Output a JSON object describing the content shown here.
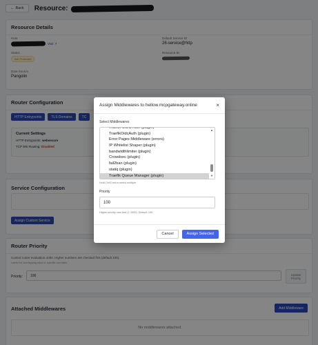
{
  "topbar": {
    "back_label": "Back",
    "title_prefix": "Resource:"
  },
  "resource_details": {
    "title": "Resource Details",
    "host_label": "Host",
    "visit_label": "Visit",
    "status_label": "Status",
    "status_value": "Not Protected",
    "datasource_label": "Data Source",
    "datasource_value": "Pangolin",
    "service_id_label": "Default Service ID",
    "service_id_value": "26-service@http",
    "resource_id_label": "Resource ID"
  },
  "router_config": {
    "title": "Router Configuration",
    "tabs": [
      "HTTP Entrypoints",
      "TLS Domains",
      "TC"
    ],
    "current_settings_title": "Current Settings",
    "http_entrypoints_label": "HTTP Entrypoints:",
    "http_entrypoints_value": "websecure",
    "tcp_sni_label": "TCP SNI Routing:",
    "tcp_sni_value": "Disabled"
  },
  "service_config": {
    "title": "Service Configuration",
    "assign_button": "Assign Custom Service"
  },
  "router_priority": {
    "title": "Router Priority",
    "description": "Control router evaluation order. Higher numbers are checked first (default 100).",
    "subdescription": "Useful for overlapping rules or specific overrides.",
    "priority_label": "Priority:",
    "priority_value": "100",
    "update_button": "Update Priority"
  },
  "attached_middlewares": {
    "title": "Attached Middlewares",
    "add_button": "Add Middleware",
    "empty_text": "No middlewares attached."
  },
  "modal": {
    "title": "Assign Middlewares to hellow.mcpgateway.online",
    "close_symbol": "×",
    "select_label": "Select Middlewares",
    "options": [
      "Traefik OIDC Auth (plugin)",
      "TraefikOidcAuth (plugin)",
      "Error Pages Middleware (errors)",
      "IP Whitelist Shaper (plugin)",
      "bandwidthlimiter (plugin)",
      "Crowdsec (plugin)",
      "fail2ban (plugin)",
      "statiq (plugin)",
      "Traefik Queue Manager (plugin)"
    ],
    "selected_index": 8,
    "select_hint": "Hold Ctrl/Cmd to select multiple",
    "priority_label": "Priority",
    "priority_value": "100",
    "priority_hint": "Higher priority runs first (1-1000). Default: 100.",
    "cancel_button": "Cancel",
    "assign_button": "Assign Selected"
  }
}
